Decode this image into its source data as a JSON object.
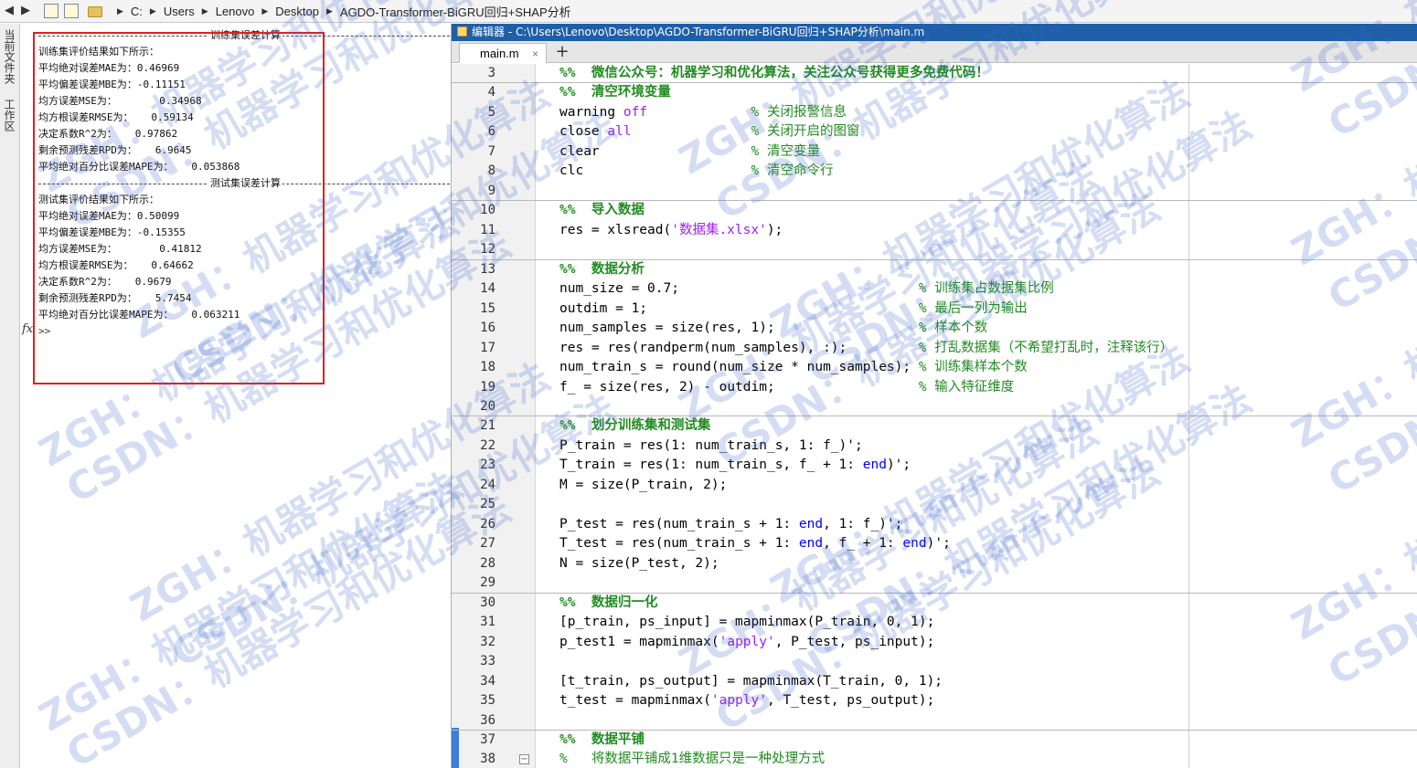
{
  "address_bar": {
    "crumbs": [
      "C:",
      "Users",
      "Lenovo",
      "Desktop",
      "AGDO-Transformer-BiGRU回归+SHAP分析"
    ]
  },
  "side_tabs": [
    "当前文件夹",
    "工作区"
  ],
  "command_window": {
    "fx_label": "fx",
    "lines": [
      {
        "type": "divider",
        "text": "训练集误差计算"
      },
      {
        "type": "text",
        "text": "训练集评价结果如下所示："
      },
      {
        "type": "text",
        "text": "平均绝对误差MAE为：0.46969"
      },
      {
        "type": "text",
        "text": "平均偏差误差MBE为：-0.11151"
      },
      {
        "type": "text",
        "text": "均方误差MSE为：       0.34968"
      },
      {
        "type": "text",
        "text": "均方根误差RMSE为：   0.59134"
      },
      {
        "type": "text",
        "text": "决定系数R^2为：   0.97862"
      },
      {
        "type": "text",
        "text": "剩余预测残差RPD为：   6.9645"
      },
      {
        "type": "text",
        "text": "平均绝对百分比误差MAPE为：   0.053868"
      },
      {
        "type": "divider",
        "text": "测试集误差计算"
      },
      {
        "type": "text",
        "text": "测试集评价结果如下所示："
      },
      {
        "type": "text",
        "text": "平均绝对误差MAE为：0.50099"
      },
      {
        "type": "text",
        "text": "平均偏差误差MBE为：-0.15355"
      },
      {
        "type": "text",
        "text": "均方误差MSE为：       0.41812"
      },
      {
        "type": "text",
        "text": "均方根误差RMSE为：   0.64662"
      },
      {
        "type": "text",
        "text": "决定系数R^2为：   0.9679"
      },
      {
        "type": "text",
        "text": "剩余预测残差RPD为：   5.7454"
      },
      {
        "type": "text",
        "text": "平均绝对百分比误差MAPE为：   0.063211"
      }
    ],
    "prompt": ">>"
  },
  "editor": {
    "title": "编辑器 - C:\\Users\\Lenovo\\Desktop\\AGDO-Transformer-BiGRU回归+SHAP分析\\main.m",
    "tab_label": "main.m",
    "tab_close": "×",
    "add_tab": "+",
    "fold_symbol": "−",
    "lines": [
      {
        "n": "3",
        "cell": true,
        "segs": [
          [
            "cellh",
            "%%  微信公众号：机器学习和优化算法，关注公众号获得更多免费代码！"
          ]
        ]
      },
      {
        "n": "4",
        "cell": true,
        "segs": [
          [
            "cellh",
            "%%  清空环境变量"
          ]
        ]
      },
      {
        "n": "5",
        "segs": [
          [
            "",
            "warning "
          ],
          [
            "str",
            "off"
          ],
          [
            "",
            "             "
          ],
          [
            "cmt",
            "% 关闭报警信息"
          ]
        ]
      },
      {
        "n": "6",
        "segs": [
          [
            "",
            "close "
          ],
          [
            "str",
            "all"
          ],
          [
            "",
            "               "
          ],
          [
            "cmt",
            "% 关闭开启的图窗"
          ]
        ]
      },
      {
        "n": "7",
        "segs": [
          [
            "",
            "clear                   "
          ],
          [
            "cmt",
            "% 清空变量"
          ]
        ]
      },
      {
        "n": "8",
        "segs": [
          [
            "",
            "clc                     "
          ],
          [
            "cmt",
            "% 清空命令行"
          ]
        ]
      },
      {
        "n": "9",
        "segs": [
          [
            "",
            ""
          ]
        ]
      },
      {
        "n": "10",
        "cell": true,
        "segs": [
          [
            "cellh",
            "%%  导入数据"
          ]
        ]
      },
      {
        "n": "11",
        "segs": [
          [
            "",
            "res = xlsread("
          ],
          [
            "str",
            "'数据集.xlsx'"
          ],
          [
            "",
            ");"
          ]
        ]
      },
      {
        "n": "12",
        "segs": [
          [
            "",
            ""
          ]
        ]
      },
      {
        "n": "13",
        "cell": true,
        "segs": [
          [
            "cellh",
            "%%  数据分析"
          ]
        ]
      },
      {
        "n": "14",
        "segs": [
          [
            "",
            "num_size = 0.7;                              "
          ],
          [
            "cmt",
            "% 训练集占数据集比例"
          ]
        ]
      },
      {
        "n": "15",
        "segs": [
          [
            "",
            "outdim = 1;                                  "
          ],
          [
            "cmt",
            "% 最后一列为输出"
          ]
        ]
      },
      {
        "n": "16",
        "segs": [
          [
            "",
            "num_samples = size(res, 1);                  "
          ],
          [
            "cmt",
            "% 样本个数"
          ]
        ]
      },
      {
        "n": "17",
        "segs": [
          [
            "",
            "res = res(randperm(num_samples), :);         "
          ],
          [
            "cmt",
            "% 打乱数据集（不希望打乱时，注释该行）"
          ]
        ]
      },
      {
        "n": "18",
        "segs": [
          [
            "",
            "num_train_s = round(num_size * num_samples); "
          ],
          [
            "cmt",
            "% 训练集样本个数"
          ]
        ]
      },
      {
        "n": "19",
        "segs": [
          [
            "",
            "f_ = size(res, 2) - outdim;                  "
          ],
          [
            "cmt",
            "% 输入特征维度"
          ]
        ]
      },
      {
        "n": "20",
        "segs": [
          [
            "",
            ""
          ]
        ]
      },
      {
        "n": "21",
        "cell": true,
        "segs": [
          [
            "cellh",
            "%%  划分训练集和测试集"
          ]
        ]
      },
      {
        "n": "22",
        "segs": [
          [
            "",
            "P_train = res(1: num_train_s, 1: f_)';"
          ]
        ]
      },
      {
        "n": "23",
        "segs": [
          [
            "",
            "T_train = res(1: num_train_s, f_ + 1: "
          ],
          [
            "kw",
            "end"
          ],
          [
            "",
            ")';"
          ]
        ]
      },
      {
        "n": "24",
        "segs": [
          [
            "",
            "M = size(P_train, 2);"
          ]
        ]
      },
      {
        "n": "25",
        "segs": [
          [
            "",
            ""
          ]
        ]
      },
      {
        "n": "26",
        "segs": [
          [
            "",
            "P_test = res(num_train_s + 1: "
          ],
          [
            "kw",
            "end"
          ],
          [
            "",
            ", 1: f_)';"
          ]
        ]
      },
      {
        "n": "27",
        "segs": [
          [
            "",
            "T_test = res(num_train_s + 1: "
          ],
          [
            "kw",
            "end"
          ],
          [
            "",
            ", f_ + 1: "
          ],
          [
            "kw",
            "end"
          ],
          [
            "",
            ")';"
          ]
        ]
      },
      {
        "n": "28",
        "segs": [
          [
            "",
            "N = size(P_test, 2);"
          ]
        ]
      },
      {
        "n": "29",
        "segs": [
          [
            "",
            ""
          ]
        ]
      },
      {
        "n": "30",
        "cell": true,
        "segs": [
          [
            "cellh",
            "%%  数据归一化"
          ]
        ]
      },
      {
        "n": "31",
        "segs": [
          [
            "",
            "[p_train, ps_input] = mapminmax(P_train, 0, 1);"
          ]
        ]
      },
      {
        "n": "32",
        "segs": [
          [
            "",
            "p_test1 = mapminmax("
          ],
          [
            "str",
            "'apply'"
          ],
          [
            "",
            ", P_test, ps_input);"
          ]
        ]
      },
      {
        "n": "33",
        "segs": [
          [
            "",
            ""
          ]
        ]
      },
      {
        "n": "34",
        "segs": [
          [
            "",
            "[t_train, ps_output] = mapminmax(T_train, 0, 1);"
          ]
        ]
      },
      {
        "n": "35",
        "segs": [
          [
            "",
            "t_test = mapminmax("
          ],
          [
            "str",
            "'apply'"
          ],
          [
            "",
            ", T_test, ps_output);"
          ]
        ]
      },
      {
        "n": "36",
        "segs": [
          [
            "",
            ""
          ]
        ]
      },
      {
        "n": "37",
        "cell": true,
        "segs": [
          [
            "cellh",
            "%%  数据平铺"
          ]
        ]
      },
      {
        "n": "38",
        "fold": true,
        "segs": [
          [
            "cmt",
            "%   将数据平铺成1维数据只是一种处理方式"
          ]
        ]
      }
    ]
  },
  "watermark": {
    "a": "ZGH：机器学习和优化算法",
    "b": "CSDN：机器学习和优化算法"
  },
  "colors": {
    "title_bar": "#1f5fa8",
    "highlight_box": "#e02020",
    "comment": "#228b22",
    "string": "#a020f0",
    "keyword": "#0000ff"
  }
}
